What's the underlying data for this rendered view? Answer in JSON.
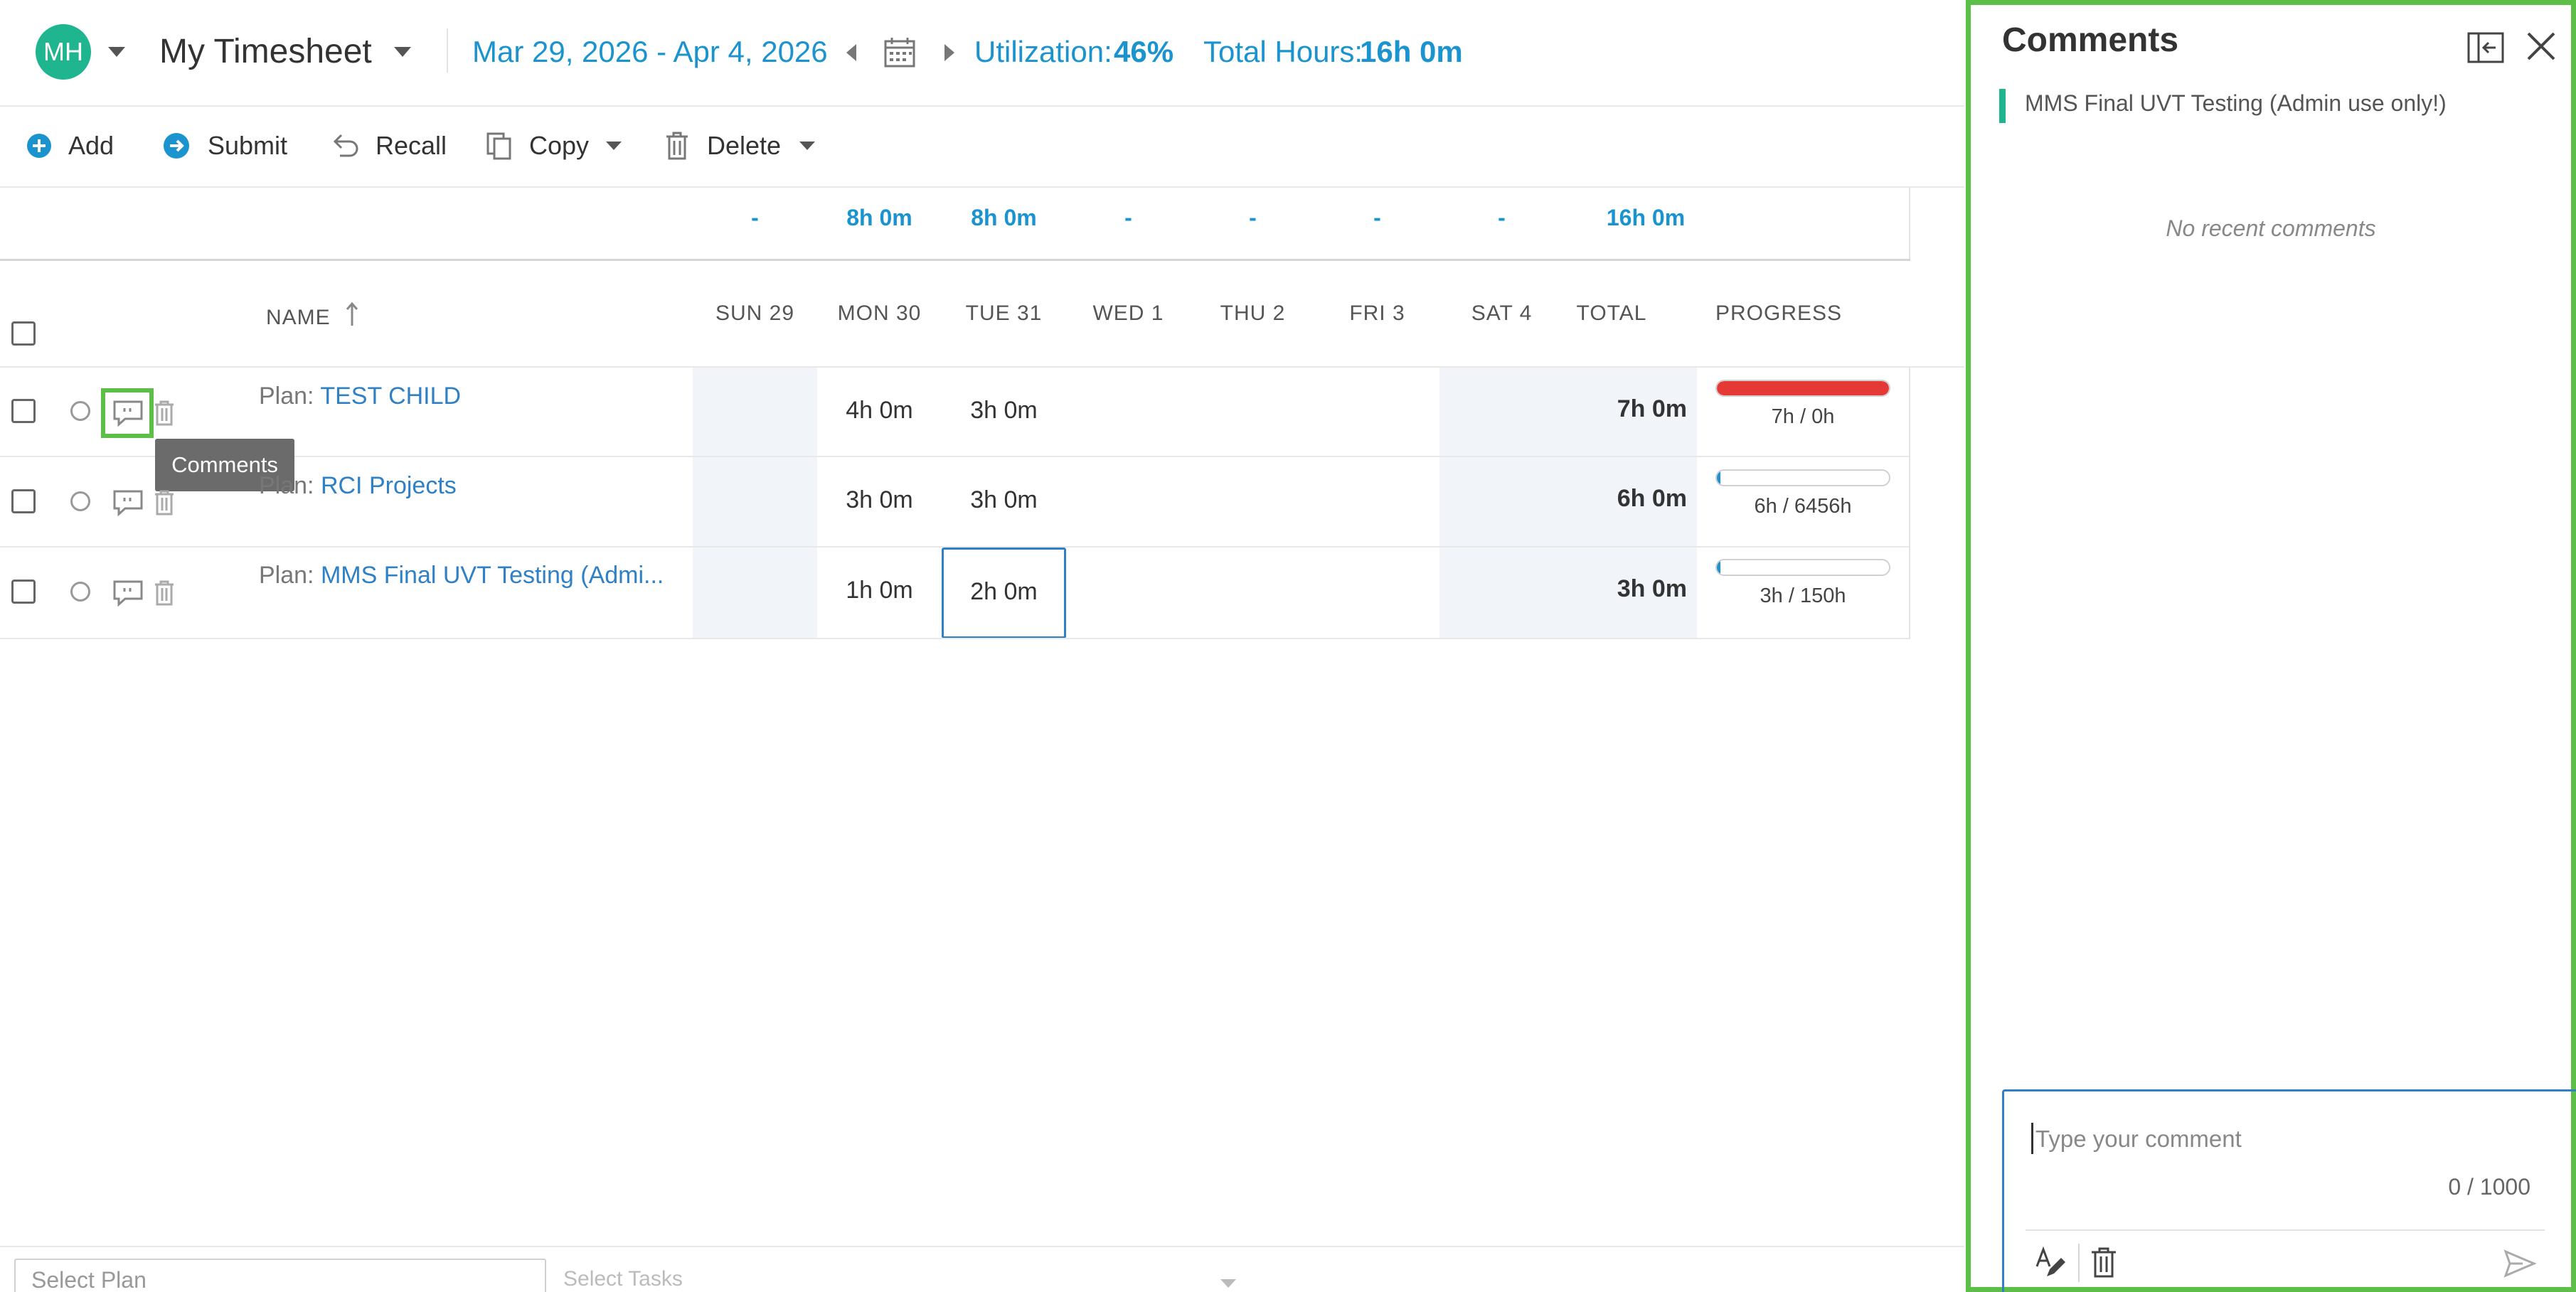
{
  "header": {
    "avatar_initials": "MH",
    "title": "My Timesheet",
    "date_range": "Mar 29, 2026 - Apr 4, 2026",
    "utilization_label": "Utilization:",
    "utilization_value": "46%",
    "total_hours_label": "Total Hours:",
    "total_hours_value": "16h 0m"
  },
  "toolbar": {
    "add": "Add",
    "submit": "Submit",
    "recall": "Recall",
    "copy": "Copy",
    "delete": "Delete"
  },
  "table": {
    "day_totals": [
      "-",
      "8h 0m",
      "8h 0m",
      "-",
      "-",
      "-",
      "-",
      "16h 0m"
    ],
    "columns": {
      "name": "NAME",
      "days": [
        "SUN 29",
        "MON 30",
        "TUE 31",
        "WED 1",
        "THU 2",
        "FRI 3",
        "SAT 4"
      ],
      "total": "TOTAL",
      "progress": "PROGRESS"
    },
    "rows": [
      {
        "prefix": "Plan:",
        "name": "TEST CHILD",
        "mon": "4h 0m",
        "tue": "3h 0m",
        "total": "7h 0m",
        "progress_text": "7h / 0h",
        "progress_fraction": 1.0,
        "progress_color": "#e53935"
      },
      {
        "prefix": "Plan:",
        "name": "RCI Projects",
        "mon": "3h 0m",
        "tue": "3h 0m",
        "total": "6h 0m",
        "progress_text": "6h / 6456h",
        "progress_fraction": 0.001,
        "progress_color": "#1a93cf"
      },
      {
        "prefix": "Plan:",
        "name": "MMS Final UVT Testing (Admi...",
        "mon": "1h 0m",
        "tue": "2h 0m",
        "total": "3h 0m",
        "progress_text": "3h / 150h",
        "progress_fraction": 0.02,
        "progress_color": "#1a93cf"
      }
    ]
  },
  "tooltip": "Comments",
  "footer": {
    "select_plan_placeholder": "Select Plan",
    "select_tasks_placeholder": "Select Tasks"
  },
  "comments": {
    "title": "Comments",
    "context": "MMS Final UVT Testing (Admin use only!)",
    "empty": "No recent comments",
    "placeholder": "Type your comment",
    "counter": "0 / 1000"
  },
  "colors": {
    "accent": "#1a93cf",
    "link": "#2f80c4",
    "highlight": "#5cbf47",
    "avatar": "#1fb58f",
    "over_budget": "#e53935"
  }
}
